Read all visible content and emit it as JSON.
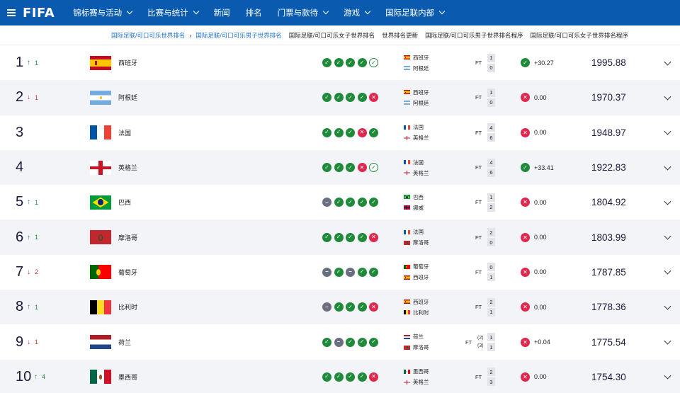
{
  "nav": {
    "logo": "FIFA",
    "items": [
      {
        "label": "锦标赛与活动",
        "dropdown": true
      },
      {
        "label": "比赛与统计",
        "dropdown": true
      },
      {
        "label": "新闻",
        "dropdown": false
      },
      {
        "label": "排名",
        "dropdown": false
      },
      {
        "label": "门票与款待",
        "dropdown": true
      },
      {
        "label": "游戏",
        "dropdown": true
      },
      {
        "label": "国际足联内部",
        "dropdown": true
      }
    ]
  },
  "breadcrumb": {
    "items": [
      {
        "label": "国际足联/可口可乐世界排名",
        "link": true
      },
      {
        "label": "国际足联/可口可乐男子世界排名",
        "link": true
      },
      {
        "label": "国际足联/可口可乐女子世界排名",
        "link": false
      },
      {
        "label": "世界排名更新",
        "link": false
      },
      {
        "label": "国际足联/可口可乐男子世界排名程序",
        "link": false
      },
      {
        "label": "国际足联/可口可乐女子世界排名程序",
        "link": false
      }
    ],
    "separator": "›"
  },
  "colors": {
    "primary": "#0a5bb0",
    "win": "#1f8a3a",
    "loss": "#e0284f",
    "draw": "#6a6f80",
    "link": "#1f6fd1"
  },
  "form_symbols": {
    "w": "✓",
    "l": "✕",
    "d": "–",
    "wp": "✓",
    "lp": "✕"
  },
  "rows": [
    {
      "rank": "1",
      "move_dir": "up",
      "move": "1",
      "team": "西班牙",
      "flag": "esp",
      "form": [
        "w",
        "w",
        "w",
        "w",
        "wp"
      ],
      "home": {
        "name": "西班牙",
        "flag": "esp"
      },
      "away": {
        "name": "阿根廷",
        "flag": "arg"
      },
      "ft": "FT",
      "home_score": "1",
      "away_score": "0",
      "pens": null,
      "points_result": "win",
      "points": "+30.27",
      "total": "1995.88"
    },
    {
      "rank": "2",
      "move_dir": "down",
      "move": "1",
      "team": "阿根廷",
      "flag": "arg",
      "form": [
        "w",
        "w",
        "w",
        "w",
        "l"
      ],
      "home": {
        "name": "西班牙",
        "flag": "esp"
      },
      "away": {
        "name": "阿根廷",
        "flag": "arg"
      },
      "ft": "FT",
      "home_score": "1",
      "away_score": "0",
      "pens": null,
      "points_result": "loss",
      "points": "0.00",
      "total": "1970.37"
    },
    {
      "rank": "3",
      "move_dir": "none",
      "move": "",
      "team": "法国",
      "flag": "fra",
      "form": [
        "w",
        "w",
        "w",
        "l",
        "w"
      ],
      "home": {
        "name": "法国",
        "flag": "fra"
      },
      "away": {
        "name": "英格兰",
        "flag": "eng"
      },
      "ft": "FT",
      "home_score": "4",
      "away_score": "6",
      "pens": null,
      "points_result": "loss",
      "points": "0.00",
      "total": "1948.97"
    },
    {
      "rank": "4",
      "move_dir": "none",
      "move": "",
      "team": "英格兰",
      "flag": "eng",
      "form": [
        "w",
        "w",
        "w",
        "l",
        "wp"
      ],
      "home": {
        "name": "法国",
        "flag": "fra"
      },
      "away": {
        "name": "英格兰",
        "flag": "eng"
      },
      "ft": "FT",
      "home_score": "4",
      "away_score": "6",
      "pens": null,
      "points_result": "win",
      "points": "+33.41",
      "total": "1922.83"
    },
    {
      "rank": "5",
      "move_dir": "up",
      "move": "1",
      "team": "巴西",
      "flag": "bra",
      "form": [
        "d",
        "w",
        "w",
        "w",
        "w"
      ],
      "home": {
        "name": "巴西",
        "flag": "bra"
      },
      "away": {
        "name": "挪威",
        "flag": "nor"
      },
      "ft": "FT",
      "home_score": "1",
      "away_score": "2",
      "pens": null,
      "points_result": "loss",
      "points": "0.00",
      "total": "1804.92"
    },
    {
      "rank": "6",
      "move_dir": "up",
      "move": "1",
      "team": "摩洛哥",
      "flag": "mar",
      "form": [
        "w",
        "w",
        "w",
        "w",
        "l"
      ],
      "home": {
        "name": "法国",
        "flag": "fra"
      },
      "away": {
        "name": "摩洛哥",
        "flag": "mar"
      },
      "ft": "FT",
      "home_score": "2",
      "away_score": "0",
      "pens": null,
      "points_result": "loss",
      "points": "0.00",
      "total": "1803.99"
    },
    {
      "rank": "7",
      "move_dir": "down",
      "move": "2",
      "team": "葡萄牙",
      "flag": "por",
      "form": [
        "d",
        "w",
        "d",
        "w",
        "w"
      ],
      "home": {
        "name": "葡萄牙",
        "flag": "por"
      },
      "away": {
        "name": "西班牙",
        "flag": "esp"
      },
      "ft": "FT",
      "home_score": "0",
      "away_score": "1",
      "pens": null,
      "points_result": "loss",
      "points": "0.00",
      "total": "1787.85"
    },
    {
      "rank": "8",
      "move_dir": "up",
      "move": "1",
      "team": "比利时",
      "flag": "bel",
      "form": [
        "d",
        "w",
        "w",
        "w",
        "l"
      ],
      "home": {
        "name": "西班牙",
        "flag": "esp"
      },
      "away": {
        "name": "比利时",
        "flag": "bel"
      },
      "ft": "FT",
      "home_score": "2",
      "away_score": "1",
      "pens": null,
      "points_result": "loss",
      "points": "0.00",
      "total": "1778.36"
    },
    {
      "rank": "9",
      "move_dir": "down",
      "move": "1",
      "team": "荷兰",
      "flag": "ned",
      "form": [
        "w",
        "d",
        "w",
        "w",
        "w"
      ],
      "home": {
        "name": "荷兰",
        "flag": "ned"
      },
      "away": {
        "name": "摩洛哥",
        "flag": "mar"
      },
      "ft": "FT",
      "home_score": "1",
      "away_score": "1",
      "pens": {
        "home": "(2)",
        "away": "(3)"
      },
      "points_result": "loss",
      "points": "+0.04",
      "total": "1775.54"
    },
    {
      "rank": "10",
      "move_dir": "up",
      "move": "4",
      "team": "墨西哥",
      "flag": "mex",
      "form": [
        "w",
        "w",
        "w",
        "w",
        "l"
      ],
      "home": {
        "name": "墨西哥",
        "flag": "mex"
      },
      "away": {
        "name": "英格兰",
        "flag": "eng"
      },
      "ft": "FT",
      "home_score": "2",
      "away_score": "3",
      "pens": null,
      "points_result": "loss",
      "points": "0.00",
      "total": "1754.30"
    }
  ]
}
